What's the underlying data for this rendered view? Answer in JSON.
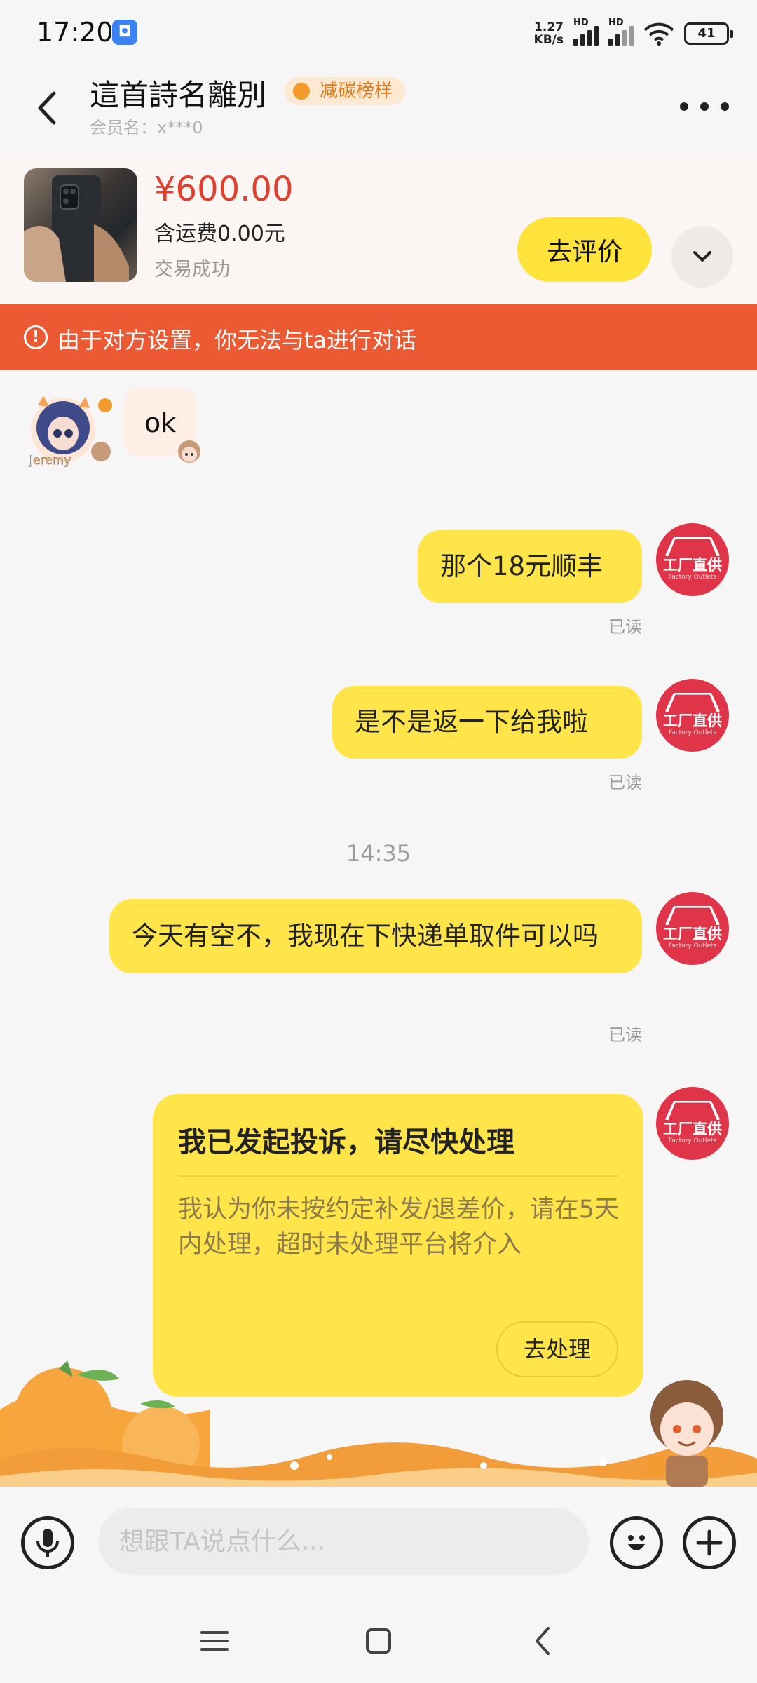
{
  "status_bar": {
    "time": "17:20",
    "net_speed_value": "1.27",
    "net_speed_unit": "KB/s",
    "network_label": "HD",
    "battery": "41"
  },
  "header": {
    "title": "這首詩名離別",
    "badge": "减碳榜样",
    "member": "会员名：x***0"
  },
  "product": {
    "price": "¥600.00",
    "shipping": "含运费0.00元",
    "status": "交易成功",
    "review_button": "去评价"
  },
  "warning": {
    "text": "由于对方设置，你无法与ta进行对话"
  },
  "messages": [
    {
      "from": "peer",
      "text": "ok"
    },
    {
      "from": "me",
      "text": "那个18元顺丰",
      "status": "已读"
    },
    {
      "from": "me",
      "text": "是不是返一下给我啦",
      "status": "已读"
    },
    {
      "from": "me",
      "text": "今天有空不，我现在下快递单取件可以吗",
      "status": "已读"
    }
  ],
  "time_divider": "14:35",
  "my_avatar": {
    "line1": "工厂直供",
    "line2": "Factory Outlets"
  },
  "peer_avatar": {
    "label": "Jeremy"
  },
  "complaint_card": {
    "title": "我已发起投诉，请尽快处理",
    "body": "我认为你未按约定补发/退差价，请在5天内处理，超时未处理平台将介入",
    "button": "去处理"
  },
  "input_bar": {
    "placeholder": "想跟TA说点什么..."
  },
  "colors": {
    "accent_yellow": "#ffe54a",
    "warning_orange": "#ec5a34",
    "price_red": "#e0412f",
    "avatar_red": "#e03448"
  }
}
